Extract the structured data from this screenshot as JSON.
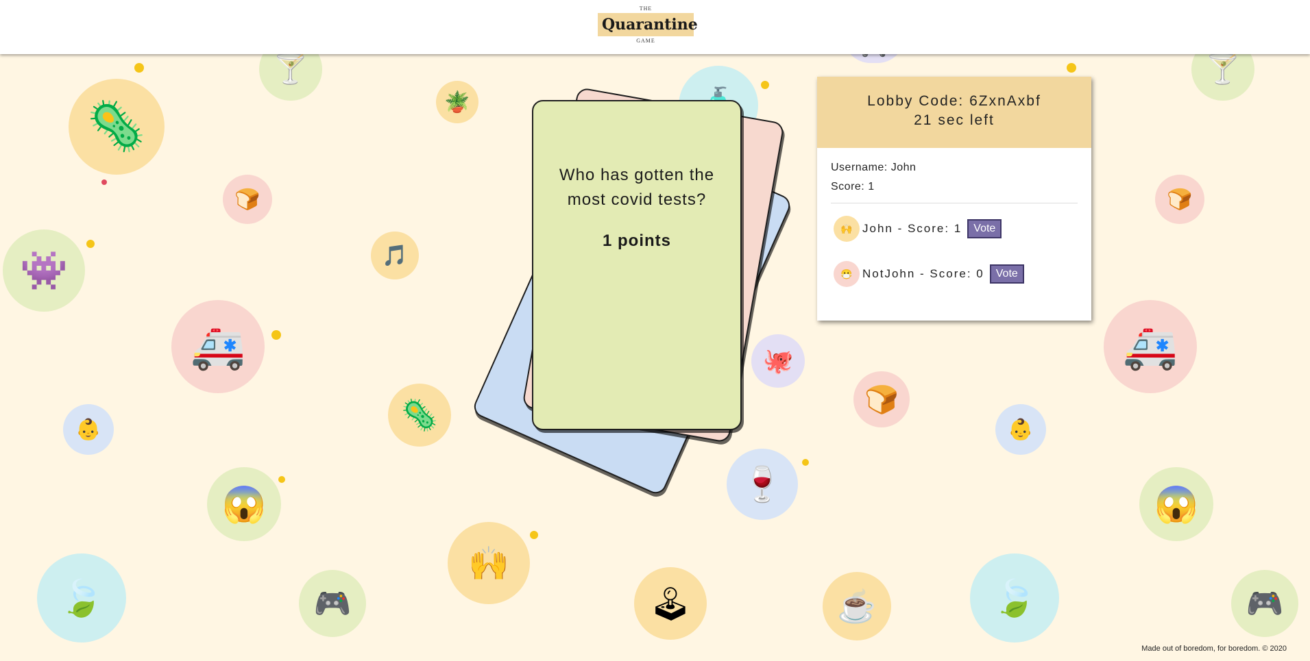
{
  "header": {
    "logo_top": "THE",
    "logo_main": "Quarantine",
    "logo_bottom": "GAME"
  },
  "card": {
    "question": "Who has gotten the most covid tests?",
    "points": "1 points"
  },
  "lobby": {
    "code_text": "Lobby Code: 6ZxnAxbf",
    "time_text": "21 sec left",
    "username_text": "Username: John",
    "score_text": "Score: 1",
    "players": [
      {
        "text": "John - Score: 1",
        "vote_label": "Vote",
        "avatar_icon": "wave-emoji-icon"
      },
      {
        "text": "NotJohn - Score: 0",
        "vote_label": "Vote",
        "avatar_icon": "masked-face-icon"
      }
    ]
  },
  "footer": {
    "text": "Made out of boredom, for boredom. © 2020"
  },
  "colors": {
    "background": "#fff6e3",
    "accent": "#f2d79e",
    "card_front": "#e3ebb4",
    "vote_button": "#7a6fa8"
  }
}
